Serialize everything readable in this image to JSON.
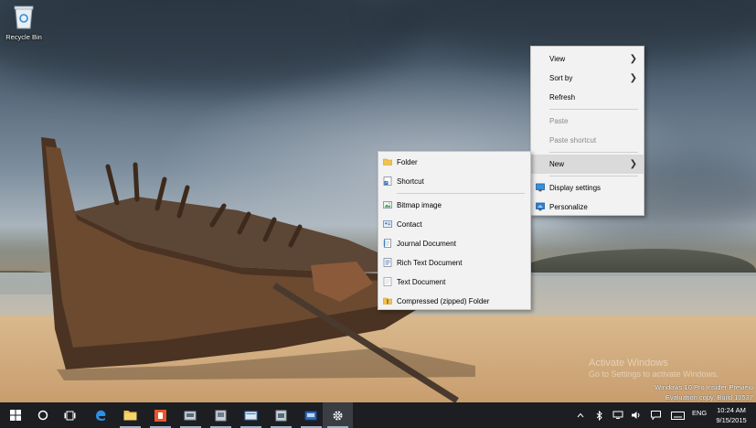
{
  "desktop": {
    "recycle_bin_label": "Recycle Bin",
    "watermark_title": "Activate Windows",
    "watermark_sub": "Go to Settings to activate Windows.",
    "build_line1": "Windows 10 Pro Insider Preview",
    "build_line2": "Evaluation copy. Build 10537"
  },
  "context_menu": {
    "items": [
      {
        "label": "View",
        "submenu": true,
        "enabled": true
      },
      {
        "label": "Sort by",
        "submenu": true,
        "enabled": true
      },
      {
        "label": "Refresh",
        "submenu": false,
        "enabled": true
      },
      {
        "label": "Paste",
        "submenu": false,
        "enabled": false
      },
      {
        "label": "Paste shortcut",
        "submenu": false,
        "enabled": false
      },
      {
        "label": "New",
        "submenu": true,
        "enabled": true,
        "highlighted": true
      },
      {
        "label": "Display settings",
        "icon": "display-settings-icon",
        "enabled": true
      },
      {
        "label": "Personalize",
        "icon": "personalize-icon",
        "enabled": true
      }
    ]
  },
  "new_submenu": {
    "items": [
      {
        "label": "Folder",
        "icon": "folder-icon"
      },
      {
        "label": "Shortcut",
        "icon": "shortcut-icon"
      },
      {
        "label": "Bitmap image",
        "icon": "bitmap-icon"
      },
      {
        "label": "Contact",
        "icon": "contact-icon"
      },
      {
        "label": "Journal Document",
        "icon": "journal-icon"
      },
      {
        "label": "Rich Text Document",
        "icon": "rich-text-icon"
      },
      {
        "label": "Text Document",
        "icon": "text-document-icon"
      },
      {
        "label": "Compressed (zipped) Folder",
        "icon": "zip-folder-icon"
      }
    ]
  },
  "taskbar": {
    "buttons": [
      "start-icon",
      "search-icon",
      "task-view-icon",
      "edge-icon",
      "file-explorer-icon",
      "office-icon",
      "app-icon",
      "app-icon",
      "app-icon",
      "app-icon",
      "app-icon",
      "settings-icon"
    ],
    "language": "ENG",
    "time": "10:24 AM",
    "date": "9/15/2015"
  },
  "colors": {
    "taskbar": "#1c1e22",
    "menu_bg": "#f2f2f2",
    "menu_highlight": "#dadada",
    "accent": "#0078d7"
  }
}
